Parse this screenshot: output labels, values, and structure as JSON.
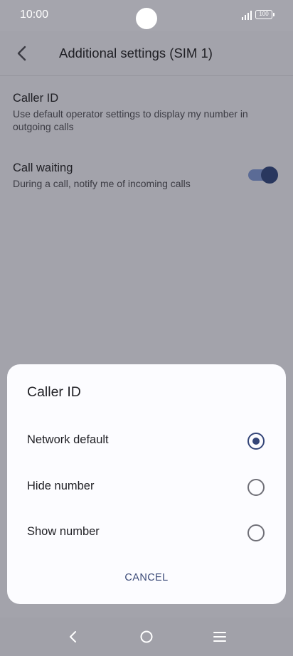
{
  "status_bar": {
    "time": "10:00",
    "battery": "100",
    "icons": [
      "signal-icon",
      "battery-icon"
    ]
  },
  "app_bar": {
    "title": "Additional settings (SIM 1)",
    "back_icon": "back-arrow-icon"
  },
  "settings": {
    "caller_id": {
      "title": "Caller ID",
      "subtitle": "Use default operator settings to display my number in outgoing calls"
    },
    "call_waiting": {
      "title": "Call waiting",
      "subtitle": "During a call, notify me of incoming calls",
      "enabled": true
    }
  },
  "dialog": {
    "title": "Caller ID",
    "options": [
      {
        "label": "Network default",
        "selected": true
      },
      {
        "label": "Hide number",
        "selected": false
      },
      {
        "label": "Show number",
        "selected": false
      }
    ],
    "cancel_label": "CANCEL"
  },
  "nav_bar": {
    "icons": [
      "back-icon",
      "home-icon",
      "recents-icon"
    ]
  },
  "colors": {
    "scrim_background": "#a3a3ab",
    "dialog_background": "#fcfcff",
    "accent": "#344578",
    "toggle_thumb": "#29375e"
  }
}
